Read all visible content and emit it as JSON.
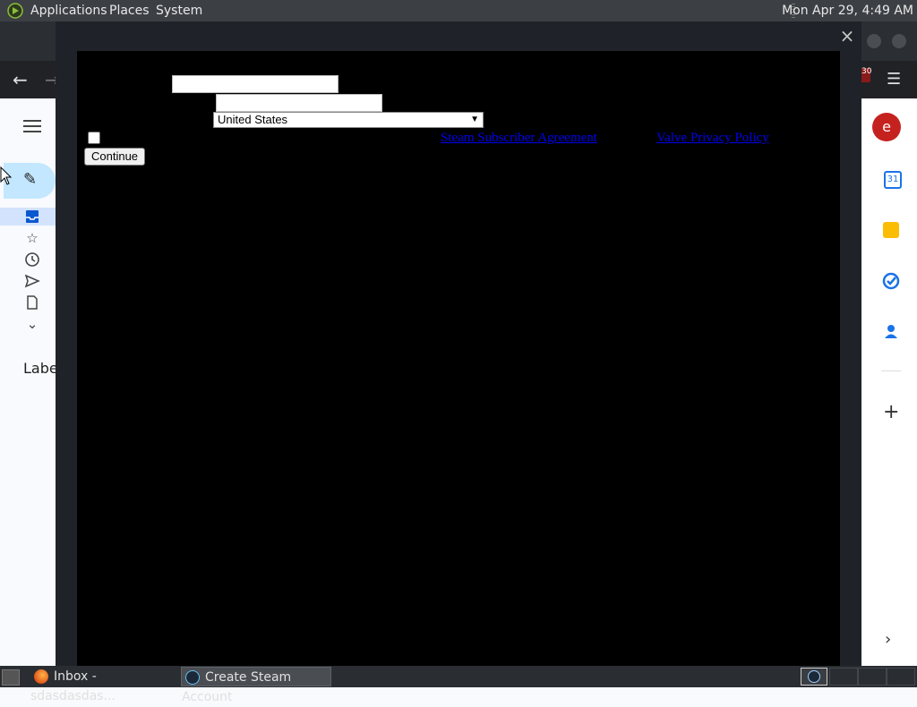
{
  "top_panel": {
    "menus": [
      "Applications",
      "Places",
      "System"
    ],
    "clock": "Mon Apr 29,  4:49 AM"
  },
  "browser": {
    "extension_badge_count": "30"
  },
  "gmail": {
    "labels_heading": "Labe",
    "avatar_letter": "e",
    "calendar_day": "31"
  },
  "modal": {
    "close_glyph": "×",
    "country_selected": "United States",
    "agreement_link": "Steam Subscriber Agreement",
    "privacy_link": "Valve Privacy Policy",
    "continue_label": "Continue"
  },
  "taskbar": {
    "items": [
      {
        "label": "Inbox - sdasdasdas...",
        "icon": "firefox-icon"
      },
      {
        "label": "Create Steam Account",
        "icon": "steam-icon"
      }
    ]
  }
}
